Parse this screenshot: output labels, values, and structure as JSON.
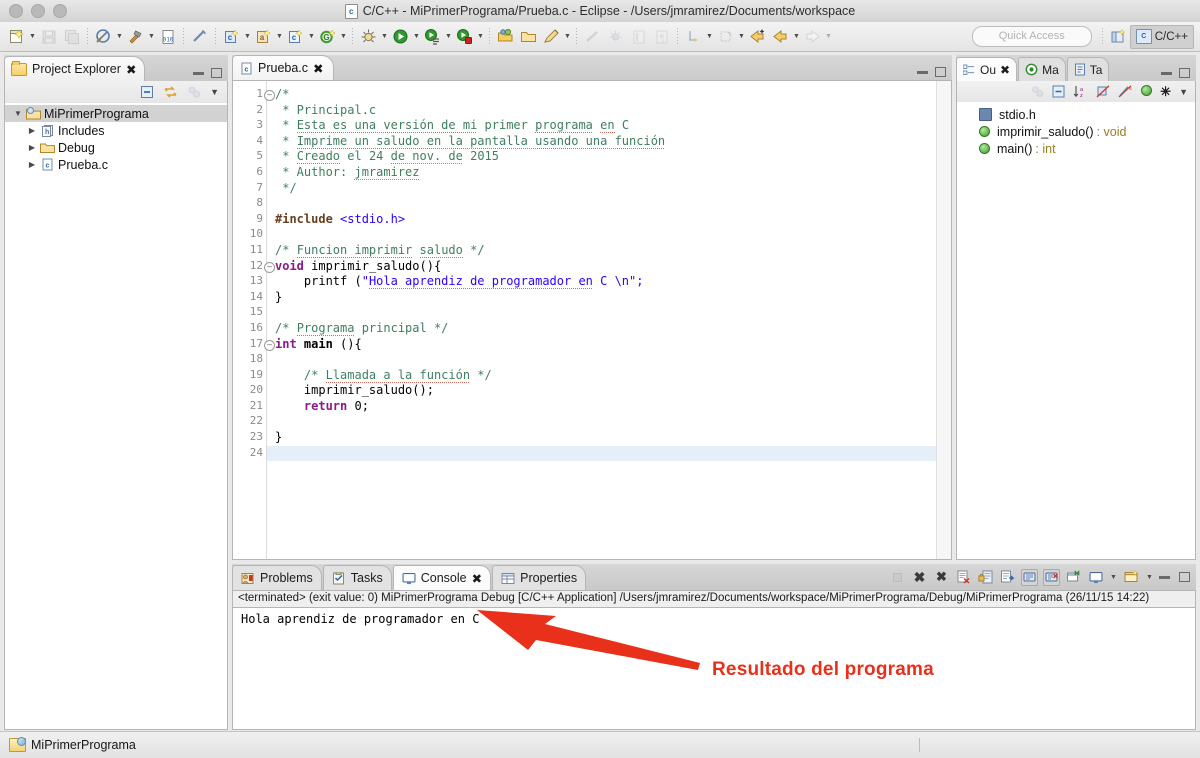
{
  "window": {
    "title": "C/C++ - MiPrimerPrograma/Prueba.c - Eclipse - /Users/jmramirez/Documents/workspace",
    "file_icon": "c-file-icon",
    "traffic_lights": [
      "close",
      "minimize",
      "zoom"
    ]
  },
  "toolbar": {
    "quick_access_placeholder": "Quick Access",
    "perspective_label": "C/C++",
    "perspective_icon": "cpp-perspective-icon",
    "open_perspective_icon": "open-perspective-icon",
    "groups": [
      {
        "items": [
          {
            "name": "new-wizard-icon",
            "glyph": "📄",
            "arrow": true
          },
          {
            "name": "save-icon",
            "glyph": "💾",
            "arrow": false,
            "disabled": true
          },
          {
            "name": "save-all-icon",
            "glyph": "🗐",
            "arrow": false,
            "disabled": true
          }
        ]
      },
      {
        "items": [
          {
            "name": "build-all-icon",
            "glyph": "⛭",
            "arrow": true
          },
          {
            "name": "build-hammer-icon",
            "glyph": "🔨",
            "arrow": true
          },
          {
            "name": "binary-010-icon",
            "glyph": "010",
            "arrow": false
          }
        ]
      },
      {
        "items": [
          {
            "name": "clean-icon",
            "glyph": "🖉",
            "arrow": false
          }
        ]
      },
      {
        "items": [
          {
            "name": "new-c-project-icon",
            "glyph": "c",
            "arrow": true
          },
          {
            "name": "new-folder-icon",
            "glyph": "a",
            "arrow": true
          },
          {
            "name": "new-c-file-icon",
            "glyph": "c",
            "arrow": true
          },
          {
            "name": "new-class-icon",
            "glyph": "G",
            "arrow": true
          }
        ]
      },
      {
        "items": [
          {
            "name": "debug-icon",
            "glyph": "🐞",
            "arrow": true
          },
          {
            "name": "run-icon",
            "glyph": "▶",
            "arrow": true
          },
          {
            "name": "run-external-tools-icon",
            "glyph": "◑",
            "arrow": true
          },
          {
            "name": "profile-icon",
            "glyph": "◉",
            "arrow": true
          }
        ]
      },
      {
        "items": [
          {
            "name": "open-resource-icon",
            "glyph": "📂",
            "arrow": false
          },
          {
            "name": "open-folder-icon",
            "glyph": "🗀",
            "arrow": false
          },
          {
            "name": "search-pencil-icon",
            "glyph": "✎",
            "arrow": true
          }
        ]
      },
      {
        "items": [
          {
            "name": "skip-breakpoints-icon",
            "glyph": "⁄",
            "arrow": false,
            "disabled": true
          },
          {
            "name": "debug-config-icon",
            "glyph": "❂",
            "arrow": false,
            "disabled": true
          },
          {
            "name": "toggle-mark-icon",
            "glyph": "▤",
            "arrow": false,
            "disabled": true
          },
          {
            "name": "show-whitespace-icon",
            "glyph": "¶",
            "arrow": false,
            "disabled": true
          }
        ]
      },
      {
        "items": [
          {
            "name": "next-annotation-icon",
            "glyph": "↳",
            "arrow": true,
            "disabled": true
          },
          {
            "name": "previous-annotation-icon",
            "glyph": "↰",
            "arrow": true,
            "disabled": true
          },
          {
            "name": "last-edit-location-icon",
            "glyph": "⇦",
            "arrow": false
          },
          {
            "name": "back-icon",
            "glyph": "⇦",
            "arrow": true
          },
          {
            "name": "forward-icon",
            "glyph": "⇨",
            "arrow": true,
            "disabled": true
          }
        ]
      }
    ]
  },
  "project_explorer": {
    "tab_label": "Project Explorer",
    "tab_icon": "project-explorer-icon",
    "close_glyph": "✖",
    "toolbar_icons": [
      {
        "name": "collapse-all-icon",
        "glyph": "⊟"
      },
      {
        "name": "link-with-editor-icon",
        "glyph": "⇄"
      },
      {
        "name": "focus-active-task-icon",
        "glyph": "◌"
      },
      {
        "name": "view-menu-icon",
        "glyph": "▽"
      }
    ],
    "tree": [
      {
        "label": "MiPrimerPrograma",
        "icon": "c-project-icon",
        "twisty": "▼",
        "indent": 0,
        "selected": true
      },
      {
        "label": "Includes",
        "icon": "includes-icon",
        "twisty": "▶",
        "indent": 1,
        "selected": false
      },
      {
        "label": "Debug",
        "icon": "folder-icon",
        "twisty": "▶",
        "indent": 1,
        "selected": false
      },
      {
        "label": "Prueba.c",
        "icon": "c-file-icon",
        "twisty": "▶",
        "indent": 1,
        "selected": false
      }
    ]
  },
  "editor": {
    "tab_label": "Prueba.c",
    "tab_icon": "c-file-icon",
    "close_glyph": "✖",
    "minimize_title": "Minimize",
    "maximize_title": "Maximize",
    "current_line": 24,
    "lines": [
      {
        "n": 1,
        "fold": "⊖",
        "segments": [
          {
            "t": "/*",
            "c": "cmt"
          }
        ]
      },
      {
        "n": 2,
        "fold": "",
        "segments": [
          {
            "t": " * Principal.c",
            "c": "cmt"
          }
        ]
      },
      {
        "n": 3,
        "fold": "",
        "segments": [
          {
            "t": " * ",
            "c": "cmt"
          },
          {
            "t": "Esta es una versión de mi",
            "c": "cmt sq"
          },
          {
            "t": " primer ",
            "c": "cmt"
          },
          {
            "t": "programa",
            "c": "cmt sq"
          },
          {
            "t": " ",
            "c": "cmt"
          },
          {
            "t": "en",
            "c": "cmt sq"
          },
          {
            "t": " C",
            "c": "cmt"
          }
        ]
      },
      {
        "n": 4,
        "fold": "",
        "segments": [
          {
            "t": " * ",
            "c": "cmt"
          },
          {
            "t": "Imprime un saludo en la pantalla usando una función",
            "c": "cmt sq"
          }
        ]
      },
      {
        "n": 5,
        "fold": "",
        "segments": [
          {
            "t": " * ",
            "c": "cmt"
          },
          {
            "t": "Creado",
            "c": "cmt sq"
          },
          {
            "t": " el 24 ",
            "c": "cmt"
          },
          {
            "t": "de nov. de",
            "c": "cmt sq"
          },
          {
            "t": " 2015",
            "c": "cmt"
          }
        ]
      },
      {
        "n": 6,
        "fold": "",
        "segments": [
          {
            "t": " * Author: ",
            "c": "cmt"
          },
          {
            "t": "jmramirez",
            "c": "cmt sq"
          }
        ]
      },
      {
        "n": 7,
        "fold": "",
        "segments": [
          {
            "t": " */",
            "c": "cmt"
          }
        ]
      },
      {
        "n": 8,
        "fold": "",
        "segments": []
      },
      {
        "n": 9,
        "fold": "",
        "segments": [
          {
            "t": "#include ",
            "c": "pp"
          },
          {
            "t": "<stdio.h>",
            "c": "str"
          }
        ]
      },
      {
        "n": 10,
        "fold": "",
        "segments": []
      },
      {
        "n": 11,
        "fold": "",
        "segments": [
          {
            "t": "/* ",
            "c": "cmt"
          },
          {
            "t": "Funcion imprimir",
            "c": "cmt sq"
          },
          {
            "t": " ",
            "c": "cmt"
          },
          {
            "t": "saludo",
            "c": "cmt sq"
          },
          {
            "t": " */",
            "c": "cmt"
          }
        ]
      },
      {
        "n": 12,
        "fold": "⊖",
        "segments": [
          {
            "t": "void",
            "c": "kw"
          },
          {
            "t": " imprimir_saludo(){",
            "c": ""
          }
        ]
      },
      {
        "n": 13,
        "fold": "",
        "segments": [
          {
            "t": "    printf (",
            "c": ""
          },
          {
            "t": "\"",
            "c": "str"
          },
          {
            "t": "Hola aprendiz de programador en",
            "c": "str sq"
          },
          {
            "t": " C \\n\";",
            "c": "str"
          }
        ]
      },
      {
        "n": 14,
        "fold": "",
        "segments": [
          {
            "t": "}",
            "c": ""
          }
        ]
      },
      {
        "n": 15,
        "fold": "",
        "segments": []
      },
      {
        "n": 16,
        "fold": "",
        "segments": [
          {
            "t": "/* ",
            "c": "cmt"
          },
          {
            "t": "Programa",
            "c": "cmt sq"
          },
          {
            "t": " principal */",
            "c": "cmt"
          }
        ]
      },
      {
        "n": 17,
        "fold": "⊖",
        "segments": [
          {
            "t": "int",
            "c": "kw"
          },
          {
            "t": " ",
            "c": ""
          },
          {
            "t": "main",
            "c": "bold"
          },
          {
            "t": " (){",
            "c": ""
          }
        ]
      },
      {
        "n": 18,
        "fold": "",
        "segments": []
      },
      {
        "n": 19,
        "fold": "",
        "segments": [
          {
            "t": "    /* ",
            "c": "cmt"
          },
          {
            "t": "Llamada a la función",
            "c": "cmt sq"
          },
          {
            "t": " */",
            "c": "cmt"
          }
        ]
      },
      {
        "n": 20,
        "fold": "",
        "segments": [
          {
            "t": "    imprimir_saludo();",
            "c": ""
          }
        ]
      },
      {
        "n": 21,
        "fold": "",
        "segments": [
          {
            "t": "    ",
            "c": ""
          },
          {
            "t": "return",
            "c": "kw"
          },
          {
            "t": " 0;",
            "c": ""
          }
        ]
      },
      {
        "n": 22,
        "fold": "",
        "segments": []
      },
      {
        "n": 23,
        "fold": "",
        "segments": [
          {
            "t": "}",
            "c": ""
          }
        ]
      },
      {
        "n": 24,
        "fold": "",
        "segments": []
      }
    ]
  },
  "outline": {
    "tabs": [
      {
        "label": "Ou",
        "icon": "outline-icon",
        "active": true,
        "close_glyph": "✖"
      },
      {
        "label": "Ma",
        "icon": "make-target-icon",
        "active": false
      },
      {
        "label": "Ta",
        "icon": "task-list-icon",
        "active": false
      }
    ],
    "toolbar_icons": [
      {
        "name": "focus-task-icon",
        "glyph": "◌"
      },
      {
        "name": "collapse-all-icon",
        "glyph": "⊟"
      },
      {
        "name": "sort-icon",
        "glyph": "↓ᵃz"
      },
      {
        "name": "hide-fields-icon",
        "glyph": "⊘"
      },
      {
        "name": "hide-static-icon",
        "glyph": "⊘ˢ"
      },
      {
        "name": "hide-nonpublic-icon",
        "glyph": "●"
      },
      {
        "name": "hide-macros-icon",
        "glyph": "✳"
      },
      {
        "name": "view-menu-icon",
        "glyph": "▽"
      }
    ],
    "items": [
      {
        "label": "stdio.h",
        "type": "",
        "icon": "include-header-icon"
      },
      {
        "label": "imprimir_saludo()",
        "type": " : void",
        "icon": "function-icon"
      },
      {
        "label": "main()",
        "type": " : int",
        "icon": "function-icon"
      }
    ]
  },
  "console": {
    "tabs": [
      {
        "label": "Problems",
        "icon": "problems-icon",
        "active": false
      },
      {
        "label": "Tasks",
        "icon": "tasks-icon",
        "active": false
      },
      {
        "label": "Console",
        "icon": "console-icon",
        "active": true,
        "close_glyph": "✖"
      },
      {
        "label": "Properties",
        "icon": "properties-icon",
        "active": false
      }
    ],
    "toolbar_icons": [
      {
        "name": "terminate-icon",
        "glyph": "■",
        "disabled": true
      },
      {
        "name": "remove-launch-icon",
        "glyph": "✖"
      },
      {
        "name": "remove-all-terminated-icon",
        "glyph": "✖✖"
      },
      {
        "name": "clear-console-icon",
        "glyph": "🗋"
      },
      {
        "name": "scroll-lock-icon",
        "glyph": "🔒"
      },
      {
        "name": "word-wrap-icon",
        "glyph": "↵"
      },
      {
        "name": "show-console-on-output-icon",
        "glyph": "▤",
        "pressed": true
      },
      {
        "name": "show-console-on-error-icon",
        "glyph": "▣",
        "pressed": true
      },
      {
        "name": "pin-console-icon",
        "glyph": "📌"
      },
      {
        "name": "display-selected-console-icon",
        "glyph": "🖥",
        "arrow": true
      },
      {
        "name": "open-console-icon",
        "glyph": "🗔",
        "arrow": true
      },
      {
        "name": "minimize-icon",
        "glyph": "—"
      },
      {
        "name": "maximize-icon",
        "glyph": "▭"
      }
    ],
    "status_line": "<terminated> (exit value: 0) MiPrimerPrograma Debug [C/C++ Application] /Users/jmramirez/Documents/workspace/MiPrimerPrograma/Debug/MiPrimerPrograma (26/11/15 14:22)",
    "output": "Hola aprendiz de programador en C"
  },
  "annotation": {
    "text": "Resultado del programa",
    "color": "#e8301a",
    "arrow_name": "red-annotation-arrow"
  },
  "statusbar": {
    "project_label": "MiPrimerPrograma",
    "project_icon": "c-project-icon"
  }
}
